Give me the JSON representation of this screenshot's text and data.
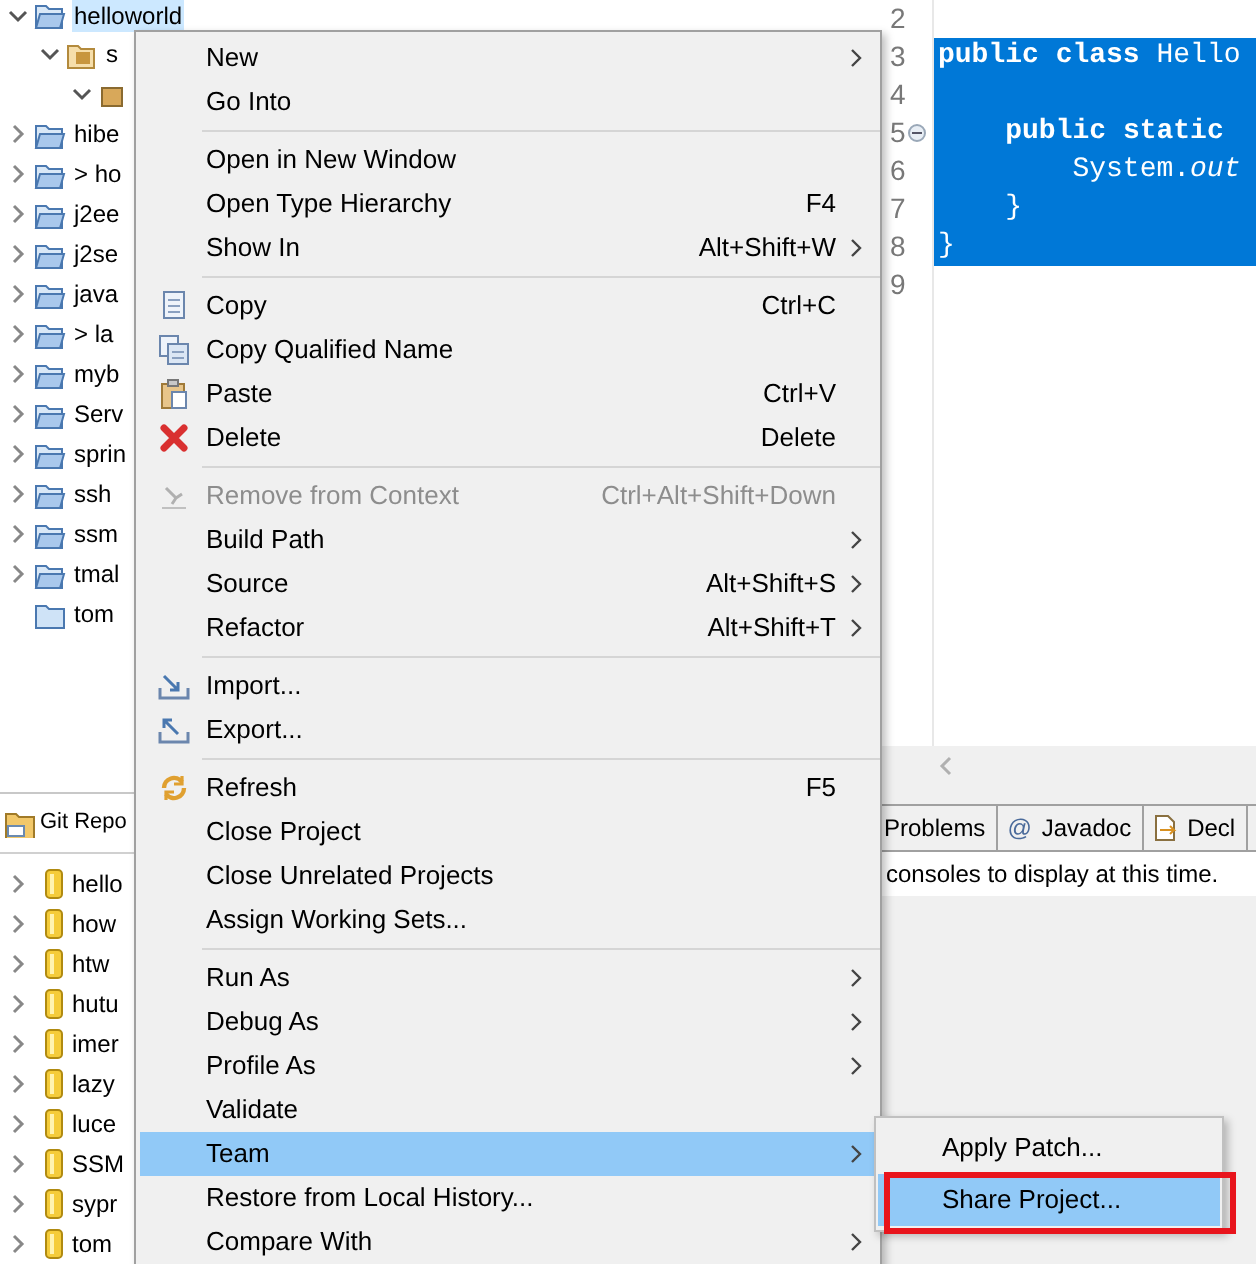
{
  "explorer": {
    "items": [
      {
        "label": "helloworld",
        "kind": "project",
        "expanded": true,
        "selected": true,
        "children": [
          {
            "label": "s",
            "kind": "sourcefolder",
            "expanded": true,
            "selected": false,
            "children": [
              {
                "kind": "package",
                "expanded": true,
                "selected": false
              }
            ]
          }
        ]
      },
      {
        "label": "hibe",
        "kind": "project",
        "expanded": false,
        "selected": false
      },
      {
        "label": "> ho",
        "kind": "project",
        "expanded": false,
        "selected": false
      },
      {
        "label": "j2ee",
        "kind": "project",
        "expanded": false,
        "selected": false
      },
      {
        "label": "j2se",
        "kind": "project",
        "expanded": false,
        "selected": false
      },
      {
        "label": "java",
        "kind": "project",
        "expanded": false,
        "selected": false
      },
      {
        "label": "> la",
        "kind": "project",
        "expanded": false,
        "selected": false
      },
      {
        "label": "myb",
        "kind": "project",
        "expanded": false,
        "selected": false
      },
      {
        "label": "Serv",
        "kind": "project",
        "expanded": false,
        "selected": false
      },
      {
        "label": "sprin",
        "kind": "project",
        "expanded": false,
        "selected": false
      },
      {
        "label": "ssh",
        "kind": "project",
        "expanded": false,
        "selected": false
      },
      {
        "label": "ssm",
        "kind": "project",
        "expanded": false,
        "selected": false
      },
      {
        "label": "tmal",
        "kind": "project",
        "expanded": false,
        "selected": false
      },
      {
        "label": "tom",
        "kind": "folder",
        "selected": false
      }
    ]
  },
  "git_repositories": {
    "title": "Git Repo",
    "items": [
      "hello",
      "how",
      "htw",
      "hutu",
      "imer",
      "lazy",
      "luce",
      "SSM",
      "sypr",
      "tom"
    ]
  },
  "editor": {
    "lines": [
      {
        "number": "2",
        "selected": false,
        "foldable": false
      },
      {
        "number": "3",
        "text": "**public** **class** Hello",
        "selected": true,
        "foldable": false
      },
      {
        "number": "4",
        "selected": true,
        "foldable": false
      },
      {
        "number": "5",
        "text": "    **public** **static**",
        "selected": true,
        "foldable": true
      },
      {
        "number": "6",
        "text": "        System.*out*",
        "selected": true,
        "foldable": false
      },
      {
        "number": "7",
        "text": "    }",
        "selected": true,
        "foldable": false
      },
      {
        "number": "8",
        "text": "}",
        "selected": true,
        "foldable": false
      },
      {
        "number": "9",
        "selected": false,
        "foldable": false
      }
    ]
  },
  "bottom_tabs": [
    {
      "label": "Problems"
    },
    {
      "label": "Javadoc",
      "glyph": "@"
    },
    {
      "label": "Decl"
    }
  ],
  "console_message": "consoles to display at this time.",
  "context_menu": {
    "groups": [
      [
        {
          "label": "New",
          "submenu": true,
          "disabled": false,
          "selected": false
        },
        {
          "label": "Go Into",
          "submenu": false,
          "disabled": false,
          "selected": false
        }
      ],
      [
        {
          "label": "Open in New Window",
          "submenu": false,
          "disabled": false,
          "selected": false
        },
        {
          "label": "Open Type Hierarchy",
          "shortcut": "F4",
          "submenu": false,
          "disabled": false,
          "selected": false
        },
        {
          "label": "Show In",
          "shortcut": "Alt+Shift+W",
          "submenu": true,
          "disabled": false,
          "selected": false
        }
      ],
      [
        {
          "label": "Copy",
          "shortcut": "Ctrl+C",
          "submenu": false,
          "disabled": false,
          "selected": false
        },
        {
          "label": "Copy Qualified Name",
          "submenu": false,
          "disabled": false,
          "selected": false
        },
        {
          "label": "Paste",
          "shortcut": "Ctrl+V",
          "submenu": false,
          "disabled": false,
          "selected": false
        },
        {
          "label": "Delete",
          "shortcut": "Delete",
          "submenu": false,
          "disabled": false,
          "selected": false
        }
      ],
      [
        {
          "label": "Remove from Context",
          "shortcut": "Ctrl+Alt+Shift+Down",
          "submenu": false,
          "disabled": true,
          "selected": false
        },
        {
          "label": "Build Path",
          "submenu": true,
          "disabled": false,
          "selected": false
        },
        {
          "label": "Source",
          "shortcut": "Alt+Shift+S",
          "submenu": true,
          "disabled": false,
          "selected": false
        },
        {
          "label": "Refactor",
          "shortcut": "Alt+Shift+T",
          "submenu": true,
          "disabled": false,
          "selected": false
        }
      ],
      [
        {
          "label": "Import...",
          "submenu": false,
          "disabled": false,
          "selected": false
        },
        {
          "label": "Export...",
          "submenu": false,
          "disabled": false,
          "selected": false
        }
      ],
      [
        {
          "label": "Refresh",
          "shortcut": "F5",
          "submenu": false,
          "disabled": false,
          "selected": false
        },
        {
          "label": "Close Project",
          "submenu": false,
          "disabled": false,
          "selected": false
        },
        {
          "label": "Close Unrelated Projects",
          "submenu": false,
          "disabled": false,
          "selected": false
        },
        {
          "label": "Assign Working Sets...",
          "submenu": false,
          "disabled": false,
          "selected": false
        }
      ],
      [
        {
          "label": "Run As",
          "submenu": true,
          "disabled": false,
          "selected": false
        },
        {
          "label": "Debug As",
          "submenu": true,
          "disabled": false,
          "selected": false
        },
        {
          "label": "Profile As",
          "submenu": true,
          "disabled": false,
          "selected": false
        },
        {
          "label": "Validate",
          "submenu": false,
          "disabled": false,
          "selected": false
        },
        {
          "label": "Team",
          "submenu": true,
          "disabled": false,
          "selected": true
        },
        {
          "label": "Restore from Local History...",
          "submenu": false,
          "disabled": false,
          "selected": false
        },
        {
          "label": "Compare With",
          "submenu": true,
          "disabled": false,
          "selected": false
        }
      ]
    ]
  },
  "team_submenu": {
    "items": [
      {
        "label": "Apply Patch...",
        "selected": false,
        "highlighted": false
      },
      {
        "label": "Share Project...",
        "selected": true,
        "highlighted": true
      }
    ]
  }
}
